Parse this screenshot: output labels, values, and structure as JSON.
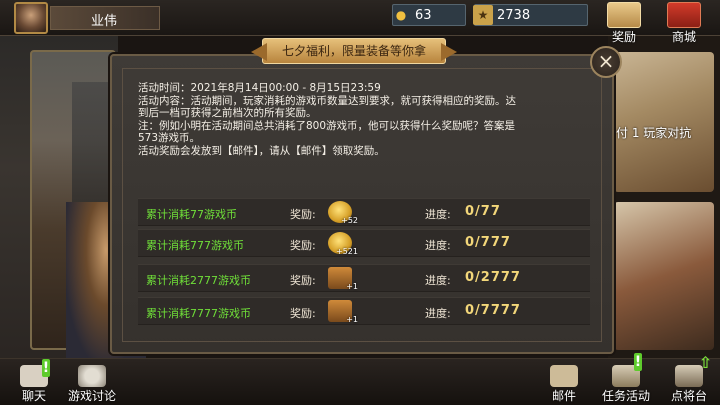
{
  "topbar": {
    "player_name": "业伟",
    "gold": "63",
    "stars": "2738",
    "reward_label": "奖励",
    "shop_label": "商城"
  },
  "background": {
    "pvp_text": "付 1 玩家对抗"
  },
  "dialog": {
    "title": "七夕福利，限量装备等你拿",
    "close_symbol": "×",
    "desc_lines": [
      "活动时间：2021年8月14日00:00 - 8月15日23:59",
      "活动内容：活动期间，玩家消耗的游戏币数量达到要求，就可获得相应的奖励。达",
      "到后一档可获得之前档次的所有奖励。",
      "注：例如小明在活动期间总共消耗了800游戏币，他可以获得什么奖励呢？答案是",
      "573游戏币。",
      "活动奖励会发放到【邮件】，请从【邮件】领取奖励。"
    ],
    "reward_label": "奖励:",
    "progress_label": "进度:",
    "rows": [
      {
        "condition": "累计消耗77游戏币",
        "qty": "+52",
        "progress": "0/77"
      },
      {
        "condition": "累计消耗777游戏币",
        "qty": "+521",
        "progress": "0/777"
      },
      {
        "condition": "累计消耗2777游戏币",
        "qty": "+1",
        "progress": "0/2777"
      },
      {
        "condition": "累计消耗7777游戏币",
        "qty": "+1",
        "progress": "0/7777"
      }
    ]
  },
  "bottombar": {
    "chat_label": "聊天",
    "forum_label": "游戏讨论",
    "mail_label": "邮件",
    "task_label": "任务活动",
    "general_label": "点将台",
    "alert_symbol": "!"
  },
  "colors": {
    "accent_gold": "#f3d77a",
    "condition_green": "#6fde39",
    "banner": "#e6c07a"
  }
}
